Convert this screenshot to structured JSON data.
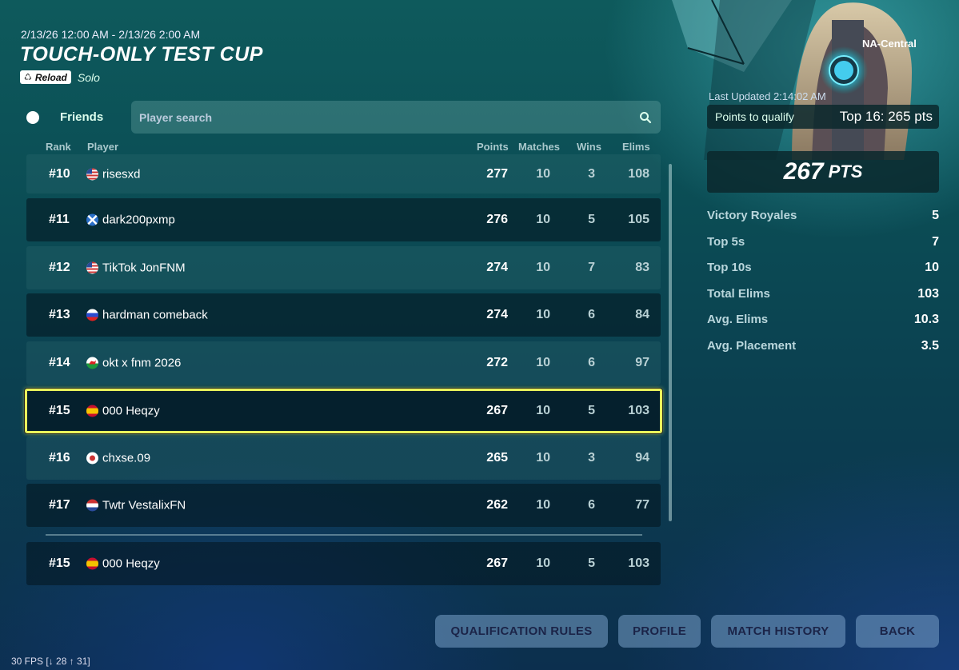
{
  "event": {
    "date_range": "2/13/26 12:00 AM - 2/13/26 2:00 AM",
    "title": "TOUCH-ONLY TEST CUP",
    "tag_label": "Reload",
    "mode": "Solo"
  },
  "region": "NA-Central",
  "last_updated": "Last Updated 2:14:02 AM",
  "qualify": {
    "label": "Points to qualify",
    "value": "Top 16: 265 pts"
  },
  "my_points": {
    "value": "267",
    "unit": "PTS"
  },
  "stats": [
    {
      "label": "Victory Royales",
      "value": "5"
    },
    {
      "label": "Top 5s",
      "value": "7"
    },
    {
      "label": "Top 10s",
      "value": "10"
    },
    {
      "label": "Total Elims",
      "value": "103"
    },
    {
      "label": "Avg. Elims",
      "value": "10.3"
    },
    {
      "label": "Avg. Placement",
      "value": "3.5"
    }
  ],
  "friends_label": "Friends",
  "search_placeholder": "Player search",
  "columns": {
    "rank": "Rank",
    "player": "Player",
    "points": "Points",
    "matches": "Matches",
    "wins": "Wins",
    "elims": "Elims"
  },
  "rows": [
    {
      "rank": "#10",
      "flag": "us",
      "name": "risesxd",
      "points": "277",
      "matches": "10",
      "wins": "3",
      "elims": "108"
    },
    {
      "rank": "#11",
      "flag": "scotland",
      "name": "dark200pxmp",
      "points": "276",
      "matches": "10",
      "wins": "5",
      "elims": "105"
    },
    {
      "rank": "#12",
      "flag": "us",
      "name": "TikTok JonFNM",
      "points": "274",
      "matches": "10",
      "wins": "7",
      "elims": "83"
    },
    {
      "rank": "#13",
      "flag": "russia",
      "name": "hardman comeback",
      "points": "274",
      "matches": "10",
      "wins": "6",
      "elims": "84"
    },
    {
      "rank": "#14",
      "flag": "wales",
      "name": "okt x fnm 2026",
      "points": "272",
      "matches": "10",
      "wins": "6",
      "elims": "97"
    },
    {
      "rank": "#15",
      "flag": "spain",
      "name": "000 Heqzy",
      "points": "267",
      "matches": "10",
      "wins": "5",
      "elims": "103"
    },
    {
      "rank": "#16",
      "flag": "japan",
      "name": "chxse.09",
      "points": "265",
      "matches": "10",
      "wins": "3",
      "elims": "94"
    },
    {
      "rank": "#17",
      "flag": "netherlands",
      "name": "Twtr VestalixFN",
      "points": "262",
      "matches": "10",
      "wins": "6",
      "elims": "77"
    }
  ],
  "self_row": {
    "rank": "#15",
    "flag": "spain",
    "name": "000 Heqzy",
    "points": "267",
    "matches": "10",
    "wins": "5",
    "elims": "103"
  },
  "buttons": {
    "qualification_rules": "QUALIFICATION RULES",
    "profile": "PROFILE",
    "match_history": "MATCH HISTORY",
    "back": "BACK"
  },
  "fps": "30 FPS [↓ 28 ↑ 31]",
  "colors": {
    "highlight": "#e9f35b",
    "button_bg": "#7aa0c8",
    "button_text": "#1b2448"
  }
}
